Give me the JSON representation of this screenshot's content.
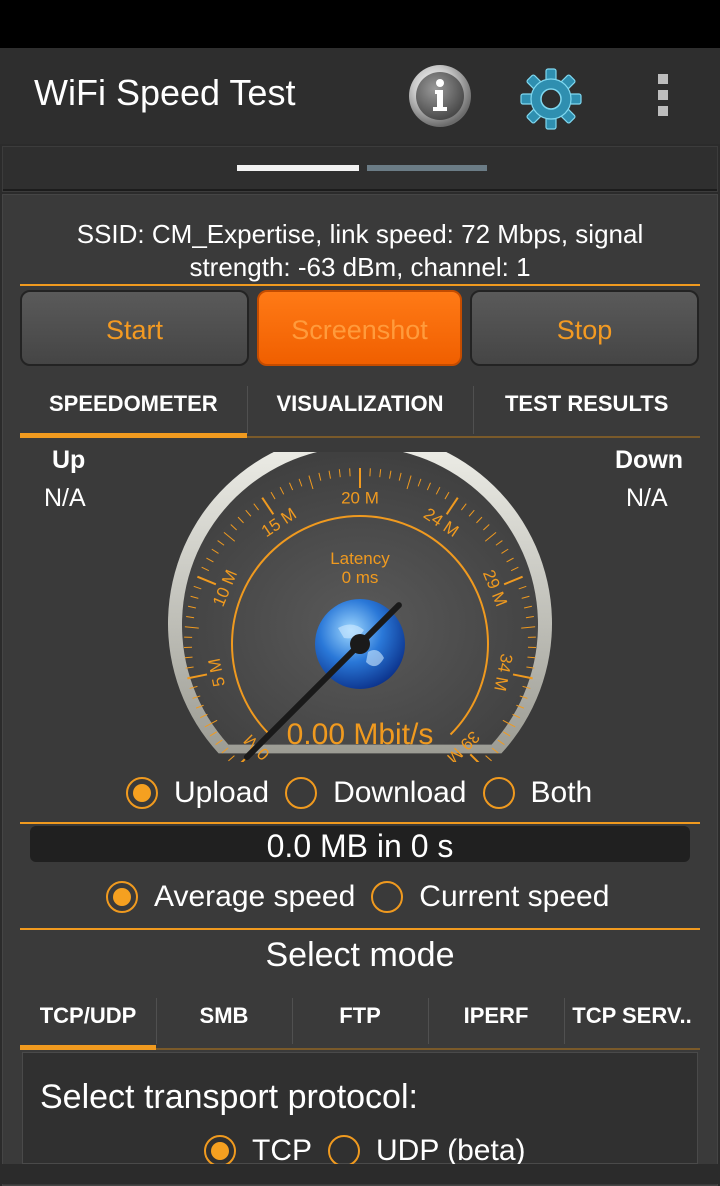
{
  "app": {
    "title": "WiFi Speed Test",
    "actions": [
      {
        "name": "info",
        "icon": "info-icon"
      },
      {
        "name": "settings",
        "icon": "gear-icon"
      },
      {
        "name": "overflow",
        "icon": "more-vert-icon"
      }
    ]
  },
  "ssid_info": "SSID: CM_Expertise, link speed: 72 Mbps, signal strength: -63 dBm, channel: 1",
  "buttons": {
    "start": "Start",
    "screenshot": "Screenshot",
    "stop": "Stop"
  },
  "tabs": [
    {
      "label": "SPEEDOMETER",
      "active": true
    },
    {
      "label": "VISUALIZATION",
      "active": false
    },
    {
      "label": "TEST RESULTS",
      "active": false
    }
  ],
  "up": {
    "label": "Up",
    "value": "N/A"
  },
  "down": {
    "label": "Down",
    "value": "N/A"
  },
  "gauge": {
    "ticks": [
      "0 M",
      "5 M",
      "10 M",
      "15 M",
      "20 M",
      "24 M",
      "29 M",
      "34 M",
      "39 M"
    ],
    "latency_label": "Latency",
    "latency_value": "0 ms",
    "speed_readout": "0.00 Mbit/s",
    "needle_value_mbps": 0,
    "max_mbps": 39
  },
  "direction": {
    "options": [
      "Upload",
      "Download",
      "Both"
    ],
    "selected": "Upload"
  },
  "transfer_summary": "0.0 MB in 0 s",
  "speed_mode": {
    "options": [
      "Average speed",
      "Current speed"
    ],
    "selected": "Average speed"
  },
  "select_mode_title": "Select mode",
  "mode_tabs": [
    {
      "label": "TCP/UDP",
      "active": true
    },
    {
      "label": "SMB",
      "active": false
    },
    {
      "label": "FTP",
      "active": false
    },
    {
      "label": "IPERF",
      "active": false
    },
    {
      "label": "TCP SERV..",
      "active": false
    }
  ],
  "transport": {
    "label": "Select transport protocol:",
    "options": [
      "TCP",
      "UDP (beta)"
    ],
    "selected": "TCP"
  },
  "colors": {
    "accent": "#f09a1f",
    "screenshot_button": "#f26400",
    "background": "#3a3a3a"
  }
}
